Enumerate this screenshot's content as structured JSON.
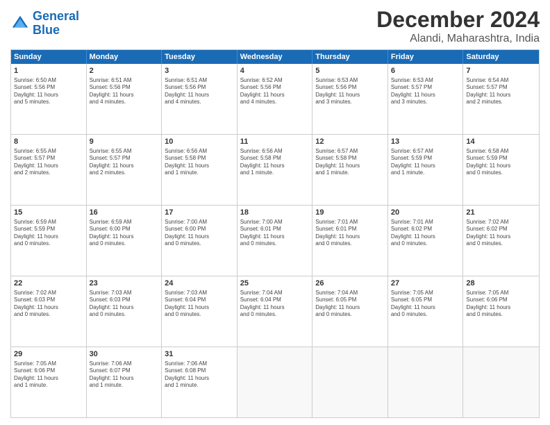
{
  "logo": {
    "line1": "General",
    "line2": "Blue"
  },
  "title": "December 2024",
  "subtitle": "Alandi, Maharashtra, India",
  "days": [
    "Sunday",
    "Monday",
    "Tuesday",
    "Wednesday",
    "Thursday",
    "Friday",
    "Saturday"
  ],
  "weeks": [
    [
      {
        "num": "1",
        "info": "Sunrise: 6:50 AM\nSunset: 5:56 PM\nDaylight: 11 hours\nand 5 minutes."
      },
      {
        "num": "2",
        "info": "Sunrise: 6:51 AM\nSunset: 5:56 PM\nDaylight: 11 hours\nand 4 minutes."
      },
      {
        "num": "3",
        "info": "Sunrise: 6:51 AM\nSunset: 5:56 PM\nDaylight: 11 hours\nand 4 minutes."
      },
      {
        "num": "4",
        "info": "Sunrise: 6:52 AM\nSunset: 5:56 PM\nDaylight: 11 hours\nand 4 minutes."
      },
      {
        "num": "5",
        "info": "Sunrise: 6:53 AM\nSunset: 5:56 PM\nDaylight: 11 hours\nand 3 minutes."
      },
      {
        "num": "6",
        "info": "Sunrise: 6:53 AM\nSunset: 5:57 PM\nDaylight: 11 hours\nand 3 minutes."
      },
      {
        "num": "7",
        "info": "Sunrise: 6:54 AM\nSunset: 5:57 PM\nDaylight: 11 hours\nand 2 minutes."
      }
    ],
    [
      {
        "num": "8",
        "info": "Sunrise: 6:55 AM\nSunset: 5:57 PM\nDaylight: 11 hours\nand 2 minutes."
      },
      {
        "num": "9",
        "info": "Sunrise: 6:55 AM\nSunset: 5:57 PM\nDaylight: 11 hours\nand 2 minutes."
      },
      {
        "num": "10",
        "info": "Sunrise: 6:56 AM\nSunset: 5:58 PM\nDaylight: 11 hours\nand 1 minute."
      },
      {
        "num": "11",
        "info": "Sunrise: 6:56 AM\nSunset: 5:58 PM\nDaylight: 11 hours\nand 1 minute."
      },
      {
        "num": "12",
        "info": "Sunrise: 6:57 AM\nSunset: 5:58 PM\nDaylight: 11 hours\nand 1 minute."
      },
      {
        "num": "13",
        "info": "Sunrise: 6:57 AM\nSunset: 5:59 PM\nDaylight: 11 hours\nand 1 minute."
      },
      {
        "num": "14",
        "info": "Sunrise: 6:58 AM\nSunset: 5:59 PM\nDaylight: 11 hours\nand 0 minutes."
      }
    ],
    [
      {
        "num": "15",
        "info": "Sunrise: 6:59 AM\nSunset: 5:59 PM\nDaylight: 11 hours\nand 0 minutes."
      },
      {
        "num": "16",
        "info": "Sunrise: 6:59 AM\nSunset: 6:00 PM\nDaylight: 11 hours\nand 0 minutes."
      },
      {
        "num": "17",
        "info": "Sunrise: 7:00 AM\nSunset: 6:00 PM\nDaylight: 11 hours\nand 0 minutes."
      },
      {
        "num": "18",
        "info": "Sunrise: 7:00 AM\nSunset: 6:01 PM\nDaylight: 11 hours\nand 0 minutes."
      },
      {
        "num": "19",
        "info": "Sunrise: 7:01 AM\nSunset: 6:01 PM\nDaylight: 11 hours\nand 0 minutes."
      },
      {
        "num": "20",
        "info": "Sunrise: 7:01 AM\nSunset: 6:02 PM\nDaylight: 11 hours\nand 0 minutes."
      },
      {
        "num": "21",
        "info": "Sunrise: 7:02 AM\nSunset: 6:02 PM\nDaylight: 11 hours\nand 0 minutes."
      }
    ],
    [
      {
        "num": "22",
        "info": "Sunrise: 7:02 AM\nSunset: 6:03 PM\nDaylight: 11 hours\nand 0 minutes."
      },
      {
        "num": "23",
        "info": "Sunrise: 7:03 AM\nSunset: 6:03 PM\nDaylight: 11 hours\nand 0 minutes."
      },
      {
        "num": "24",
        "info": "Sunrise: 7:03 AM\nSunset: 6:04 PM\nDaylight: 11 hours\nand 0 minutes."
      },
      {
        "num": "25",
        "info": "Sunrise: 7:04 AM\nSunset: 6:04 PM\nDaylight: 11 hours\nand 0 minutes."
      },
      {
        "num": "26",
        "info": "Sunrise: 7:04 AM\nSunset: 6:05 PM\nDaylight: 11 hours\nand 0 minutes."
      },
      {
        "num": "27",
        "info": "Sunrise: 7:05 AM\nSunset: 6:05 PM\nDaylight: 11 hours\nand 0 minutes."
      },
      {
        "num": "28",
        "info": "Sunrise: 7:05 AM\nSunset: 6:06 PM\nDaylight: 11 hours\nand 0 minutes."
      }
    ],
    [
      {
        "num": "29",
        "info": "Sunrise: 7:05 AM\nSunset: 6:06 PM\nDaylight: 11 hours\nand 1 minute."
      },
      {
        "num": "30",
        "info": "Sunrise: 7:06 AM\nSunset: 6:07 PM\nDaylight: 11 hours\nand 1 minute."
      },
      {
        "num": "31",
        "info": "Sunrise: 7:06 AM\nSunset: 6:08 PM\nDaylight: 11 hours\nand 1 minute."
      },
      {
        "num": "",
        "info": ""
      },
      {
        "num": "",
        "info": ""
      },
      {
        "num": "",
        "info": ""
      },
      {
        "num": "",
        "info": ""
      }
    ]
  ]
}
